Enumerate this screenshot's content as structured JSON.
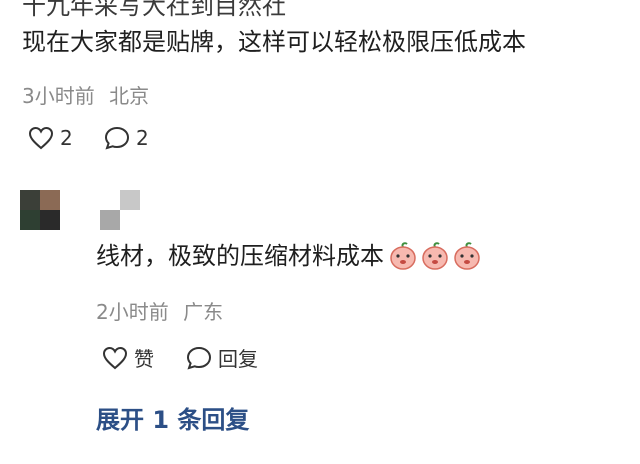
{
  "top_comment": {
    "cut_line": "十九年采写大社到目然社",
    "text": "现在大家都是贴牌，这样可以轻松极限压低成本",
    "time": "3小时前",
    "location": "北京",
    "like_count": "2",
    "reply_count": "2"
  },
  "reply": {
    "text": "线材，极致的压缩材料成本",
    "emoji_icon": "peach-emoji-icon",
    "emoji_count": 3,
    "time": "2小时前",
    "location": "广东",
    "like_label": "赞",
    "reply_label": "回复"
  },
  "expand_label": "展开 1 条回复",
  "colors": {
    "link": "#2c4f86",
    "meta": "#8a8a8a",
    "avatar_a": [
      "#3b3f38",
      "#8b6a55",
      "#2e3f32",
      "#2a2a2a"
    ],
    "avatar_b": [
      "#ffffff",
      "#c8c8c8",
      "#a8a8a8",
      "#ffffff"
    ]
  }
}
